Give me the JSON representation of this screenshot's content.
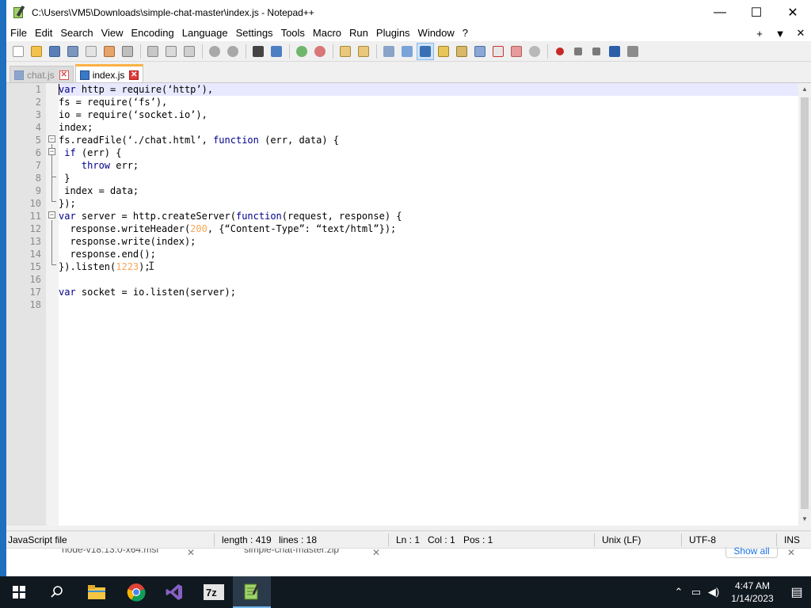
{
  "window": {
    "title": "C:\\Users\\VM5\\Downloads\\simple-chat-master\\index.js - Notepad++",
    "controls": {
      "minimize": "—",
      "maximize": "☐",
      "close": "✕"
    }
  },
  "menu": {
    "items": [
      "File",
      "Edit",
      "Search",
      "View",
      "Encoding",
      "Language",
      "Settings",
      "Tools",
      "Macro",
      "Run",
      "Plugins",
      "Window",
      "?"
    ],
    "right": {
      "plus": "+",
      "dropdown": "▼",
      "close": "✕"
    }
  },
  "tabs": [
    {
      "label": "chat.js",
      "active": false
    },
    {
      "label": "index.js",
      "active": true
    }
  ],
  "editor": {
    "lines": [
      "var http = require(‘http’),",
      "fs = require(‘fs’),",
      "io = require(‘socket.io’),",
      "index;",
      "fs.readFile(‘./chat.html’, function (err, data) {",
      " if (err) {",
      "    throw err;",
      " }",
      " index = data;",
      "});",
      "var server = http.createServer(function(request, response) {",
      "  response.writeHeader(200, {“Content-Type”: “text/html”});",
      "  response.write(index);",
      "  response.end();",
      "}).listen(1223);",
      "",
      "var socket = io.listen(server);",
      ""
    ],
    "line_numbers": [
      "1",
      "2",
      "3",
      "4",
      "5",
      "6",
      "7",
      "8",
      "9",
      "10",
      "11",
      "12",
      "13",
      "14",
      "15",
      "16",
      "17",
      "18"
    ]
  },
  "status": {
    "file_type": "JavaScript file",
    "length": "length : 419",
    "lines": "lines : 18",
    "ln": "Ln : 1",
    "col": "Col : 1",
    "pos": "Pos : 1",
    "eol": "Unix (LF)",
    "encoding": "UTF-8",
    "mode": "INS"
  },
  "downloads": {
    "item1": "node-v18.13.0-x64.msi",
    "item2": "simple-chat-master.zip",
    "show_all": "Show all"
  },
  "taskbar": {
    "time": "4:47 AM",
    "date": "1/14/2023",
    "apps": [
      "file-explorer",
      "chrome",
      "visual-studio",
      "7zip",
      "notepad-plus-plus"
    ]
  }
}
